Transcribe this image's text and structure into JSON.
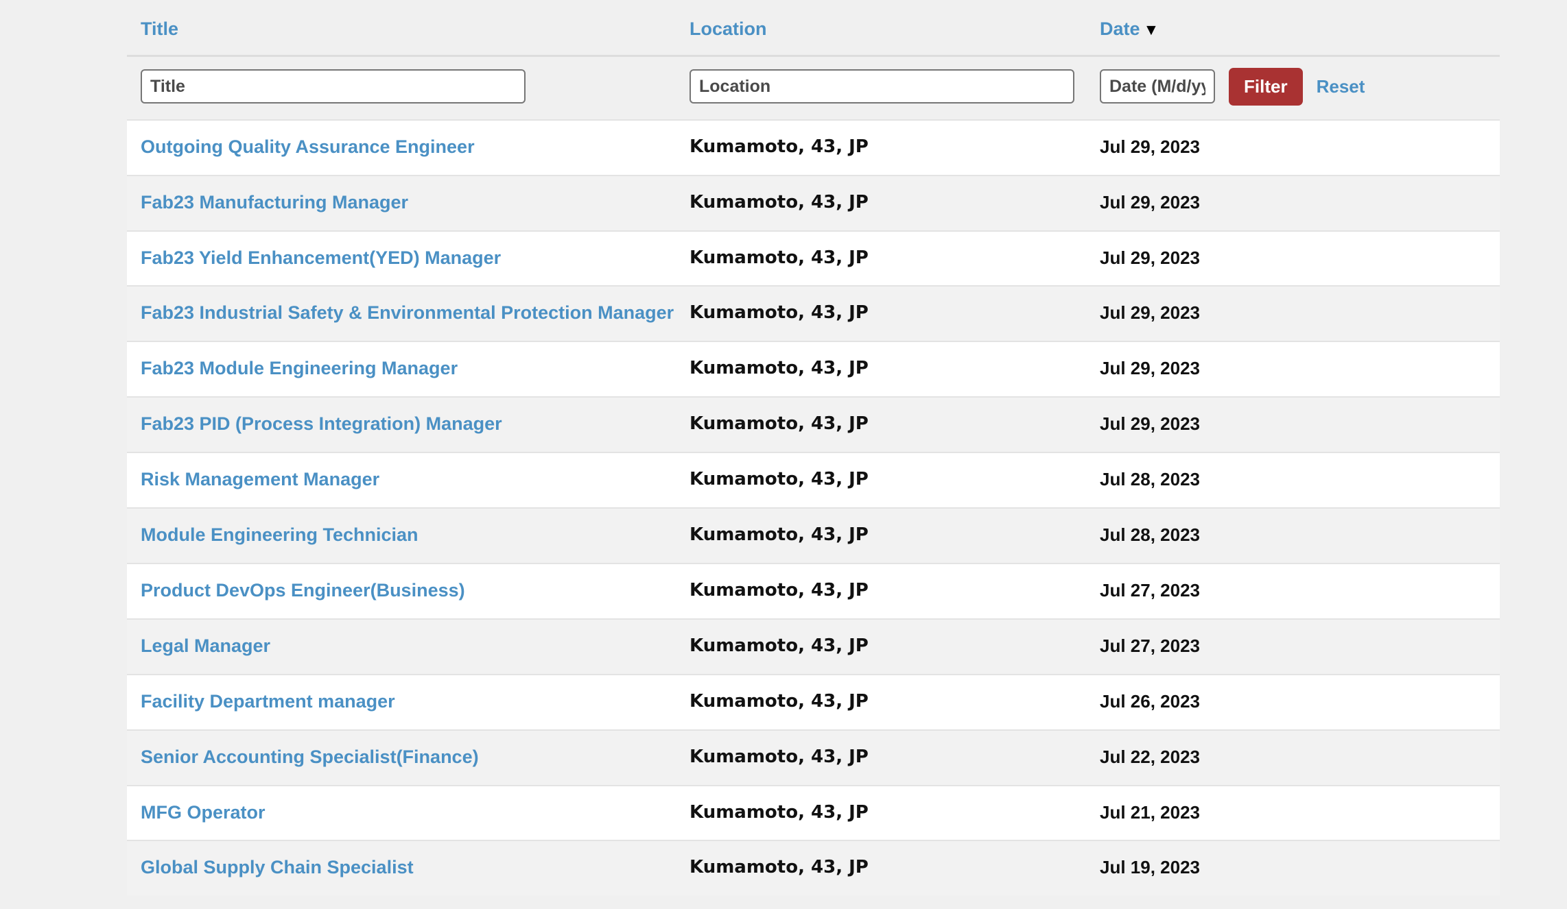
{
  "table": {
    "columns": [
      {
        "key": "title",
        "label": "Title",
        "sorted": false,
        "sort_icon": ""
      },
      {
        "key": "location",
        "label": "Location",
        "sorted": false,
        "sort_icon": ""
      },
      {
        "key": "date",
        "label": "Date",
        "sorted": true,
        "sort_icon": "▼"
      }
    ],
    "filters": {
      "title_value": "",
      "title_placeholder": "Title",
      "location_value": "",
      "location_placeholder": "Location",
      "date_value": "",
      "date_placeholder": "Date (M/d/yyyy)",
      "filter_button": "Filter",
      "reset_link": "Reset"
    },
    "rows": [
      {
        "title": "Outgoing Quality Assurance Engineer",
        "location": "Kumamoto, 43, JP",
        "date": "Jul 29, 2023"
      },
      {
        "title": "Fab23 Manufacturing Manager",
        "location": "Kumamoto, 43, JP",
        "date": "Jul 29, 2023"
      },
      {
        "title": "Fab23 Yield Enhancement(YED) Manager",
        "location": "Kumamoto, 43, JP",
        "date": "Jul 29, 2023"
      },
      {
        "title": "Fab23 Industrial Safety & Environmental Protection Manager",
        "location": "Kumamoto, 43, JP",
        "date": "Jul 29, 2023"
      },
      {
        "title": "Fab23 Module Engineering Manager",
        "location": "Kumamoto, 43, JP",
        "date": "Jul 29, 2023"
      },
      {
        "title": "Fab23 PID (Process Integration) Manager",
        "location": "Kumamoto, 43, JP",
        "date": "Jul 29, 2023"
      },
      {
        "title": "Risk Management Manager",
        "location": "Kumamoto, 43, JP",
        "date": "Jul 28, 2023"
      },
      {
        "title": "Module Engineering Technician",
        "location": "Kumamoto, 43, JP",
        "date": "Jul 28, 2023"
      },
      {
        "title": "Product DevOps Engineer(Business)",
        "location": "Kumamoto, 43, JP",
        "date": "Jul 27, 2023"
      },
      {
        "title": "Legal Manager",
        "location": "Kumamoto, 43, JP",
        "date": "Jul 27, 2023"
      },
      {
        "title": "Facility Department manager",
        "location": "Kumamoto, 43, JP",
        "date": "Jul 26, 2023"
      },
      {
        "title": "Senior Accounting Specialist(Finance)",
        "location": "Kumamoto, 43, JP",
        "date": "Jul 22, 2023"
      },
      {
        "title": "MFG Operator",
        "location": "Kumamoto, 43, JP",
        "date": "Jul 21, 2023"
      },
      {
        "title": "Global Supply Chain Specialist",
        "location": "Kumamoto, 43, JP",
        "date": "Jul 19, 2023"
      }
    ]
  },
  "colors": {
    "link": "#4a90c4",
    "filter_button_bg": "#a93232",
    "page_bg": "#f0f0f0",
    "row_alt_bg": "#f2f2f2",
    "row_bg": "#ffffff",
    "row_border": "#e3e3e3"
  }
}
